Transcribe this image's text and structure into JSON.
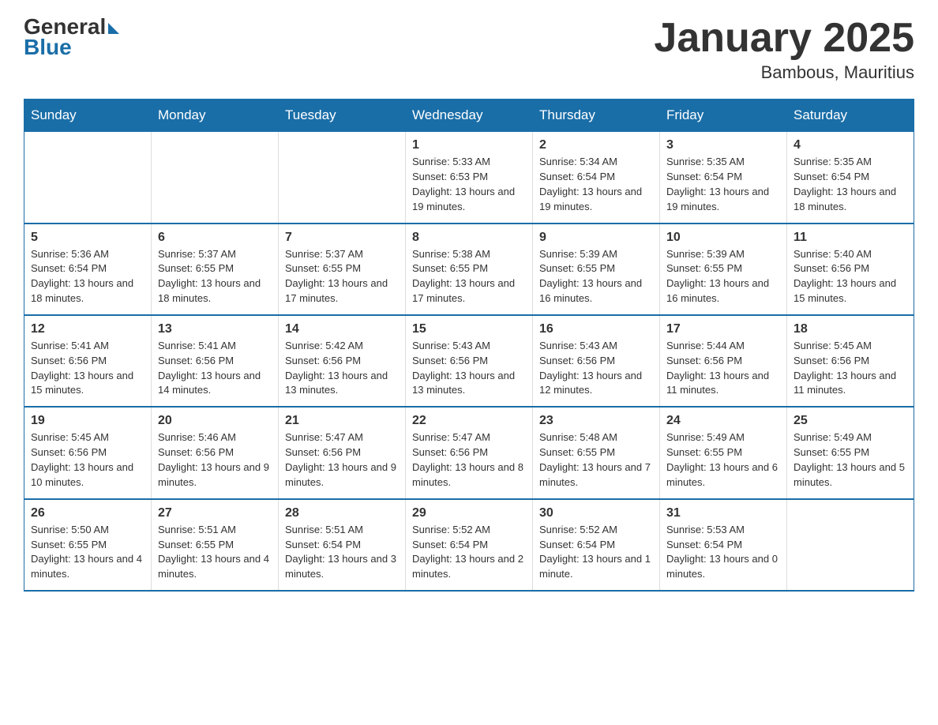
{
  "logo": {
    "general": "General",
    "blue": "Blue"
  },
  "title": "January 2025",
  "subtitle": "Bambous, Mauritius",
  "weekdays": [
    "Sunday",
    "Monday",
    "Tuesday",
    "Wednesday",
    "Thursday",
    "Friday",
    "Saturday"
  ],
  "weeks": [
    [
      {
        "day": "",
        "info": ""
      },
      {
        "day": "",
        "info": ""
      },
      {
        "day": "",
        "info": ""
      },
      {
        "day": "1",
        "info": "Sunrise: 5:33 AM\nSunset: 6:53 PM\nDaylight: 13 hours and 19 minutes."
      },
      {
        "day": "2",
        "info": "Sunrise: 5:34 AM\nSunset: 6:54 PM\nDaylight: 13 hours and 19 minutes."
      },
      {
        "day": "3",
        "info": "Sunrise: 5:35 AM\nSunset: 6:54 PM\nDaylight: 13 hours and 19 minutes."
      },
      {
        "day": "4",
        "info": "Sunrise: 5:35 AM\nSunset: 6:54 PM\nDaylight: 13 hours and 18 minutes."
      }
    ],
    [
      {
        "day": "5",
        "info": "Sunrise: 5:36 AM\nSunset: 6:54 PM\nDaylight: 13 hours and 18 minutes."
      },
      {
        "day": "6",
        "info": "Sunrise: 5:37 AM\nSunset: 6:55 PM\nDaylight: 13 hours and 18 minutes."
      },
      {
        "day": "7",
        "info": "Sunrise: 5:37 AM\nSunset: 6:55 PM\nDaylight: 13 hours and 17 minutes."
      },
      {
        "day": "8",
        "info": "Sunrise: 5:38 AM\nSunset: 6:55 PM\nDaylight: 13 hours and 17 minutes."
      },
      {
        "day": "9",
        "info": "Sunrise: 5:39 AM\nSunset: 6:55 PM\nDaylight: 13 hours and 16 minutes."
      },
      {
        "day": "10",
        "info": "Sunrise: 5:39 AM\nSunset: 6:55 PM\nDaylight: 13 hours and 16 minutes."
      },
      {
        "day": "11",
        "info": "Sunrise: 5:40 AM\nSunset: 6:56 PM\nDaylight: 13 hours and 15 minutes."
      }
    ],
    [
      {
        "day": "12",
        "info": "Sunrise: 5:41 AM\nSunset: 6:56 PM\nDaylight: 13 hours and 15 minutes."
      },
      {
        "day": "13",
        "info": "Sunrise: 5:41 AM\nSunset: 6:56 PM\nDaylight: 13 hours and 14 minutes."
      },
      {
        "day": "14",
        "info": "Sunrise: 5:42 AM\nSunset: 6:56 PM\nDaylight: 13 hours and 13 minutes."
      },
      {
        "day": "15",
        "info": "Sunrise: 5:43 AM\nSunset: 6:56 PM\nDaylight: 13 hours and 13 minutes."
      },
      {
        "day": "16",
        "info": "Sunrise: 5:43 AM\nSunset: 6:56 PM\nDaylight: 13 hours and 12 minutes."
      },
      {
        "day": "17",
        "info": "Sunrise: 5:44 AM\nSunset: 6:56 PM\nDaylight: 13 hours and 11 minutes."
      },
      {
        "day": "18",
        "info": "Sunrise: 5:45 AM\nSunset: 6:56 PM\nDaylight: 13 hours and 11 minutes."
      }
    ],
    [
      {
        "day": "19",
        "info": "Sunrise: 5:45 AM\nSunset: 6:56 PM\nDaylight: 13 hours and 10 minutes."
      },
      {
        "day": "20",
        "info": "Sunrise: 5:46 AM\nSunset: 6:56 PM\nDaylight: 13 hours and 9 minutes."
      },
      {
        "day": "21",
        "info": "Sunrise: 5:47 AM\nSunset: 6:56 PM\nDaylight: 13 hours and 9 minutes."
      },
      {
        "day": "22",
        "info": "Sunrise: 5:47 AM\nSunset: 6:56 PM\nDaylight: 13 hours and 8 minutes."
      },
      {
        "day": "23",
        "info": "Sunrise: 5:48 AM\nSunset: 6:55 PM\nDaylight: 13 hours and 7 minutes."
      },
      {
        "day": "24",
        "info": "Sunrise: 5:49 AM\nSunset: 6:55 PM\nDaylight: 13 hours and 6 minutes."
      },
      {
        "day": "25",
        "info": "Sunrise: 5:49 AM\nSunset: 6:55 PM\nDaylight: 13 hours and 5 minutes."
      }
    ],
    [
      {
        "day": "26",
        "info": "Sunrise: 5:50 AM\nSunset: 6:55 PM\nDaylight: 13 hours and 4 minutes."
      },
      {
        "day": "27",
        "info": "Sunrise: 5:51 AM\nSunset: 6:55 PM\nDaylight: 13 hours and 4 minutes."
      },
      {
        "day": "28",
        "info": "Sunrise: 5:51 AM\nSunset: 6:54 PM\nDaylight: 13 hours and 3 minutes."
      },
      {
        "day": "29",
        "info": "Sunrise: 5:52 AM\nSunset: 6:54 PM\nDaylight: 13 hours and 2 minutes."
      },
      {
        "day": "30",
        "info": "Sunrise: 5:52 AM\nSunset: 6:54 PM\nDaylight: 13 hours and 1 minute."
      },
      {
        "day": "31",
        "info": "Sunrise: 5:53 AM\nSunset: 6:54 PM\nDaylight: 13 hours and 0 minutes."
      },
      {
        "day": "",
        "info": ""
      }
    ]
  ]
}
